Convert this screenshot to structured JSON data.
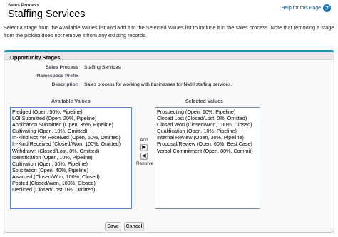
{
  "header": {
    "breadcrumb": "Sales Process",
    "title": "Staffing Services",
    "help_link": "Help for this Page",
    "help_icon": "?"
  },
  "instructions": "Select a stage from the Available Values list and add it to the Selected Values list to include it in the sales process. Note that removing a stage from the picklist does not remove it from any existing records.",
  "panel": {
    "title": "Opportunity Stages",
    "fields": [
      {
        "label": "Sales Process",
        "value": "Staffing Services"
      },
      {
        "label": "Namespace Prefix",
        "value": ""
      },
      {
        "label": "Description",
        "value": "Sales process for working with businesses for NMH staffing services."
      }
    ],
    "available_heading": "Available Values",
    "selected_heading": "Selected Values",
    "add_label": "Add",
    "remove_label": "Remove",
    "add_icon": "▶",
    "remove_icon": "◀",
    "available_values": [
      "Pledged (Open, 50%, Pipeline)",
      "LOI Submitted (Open, 20%, Pipeline)",
      "Application Submitted (Open, 35%, Pipeline)",
      "Cultivating (Open, 10%, Omitted)",
      "In-Kind Not Yet Received (Open, 50%, Omitted)",
      "In-Kind Received (Closed/Won, 100%, Omitted)",
      "Withdrawn (Closed/Lost, 0%, Omitted)",
      "Identification (Open, 10%, Pipeline)",
      "Cultivation (Open, 30%, Pipeline)",
      "Solicitation (Open, 40%, Pipeline)",
      "Awarded (Closed/Won, 100%, Closed)",
      "Posted (Closed/Won, 100%, Closed)",
      "Declined (Closed/Lost, 0%, Omitted)"
    ],
    "selected_values": [
      "Prospecting (Open, 10%, Pipeline)",
      "Closed Lost (Closed/Lost, 0%, Omitted)",
      "Closed Won (Closed/Won, 100%, Closed)",
      "Qualification (Open, 10%, Pipeline)",
      "Internal Review (Open, 30%, Pipeline)",
      "Proposal/Review (Open, 60%, Best Case)",
      "Verbal Commitment (Open, 80%, Commit)"
    ],
    "save_label": "Save",
    "cancel_label": "Cancel"
  },
  "colors": {
    "accent": "#1797c0",
    "link": "#015ba7"
  }
}
